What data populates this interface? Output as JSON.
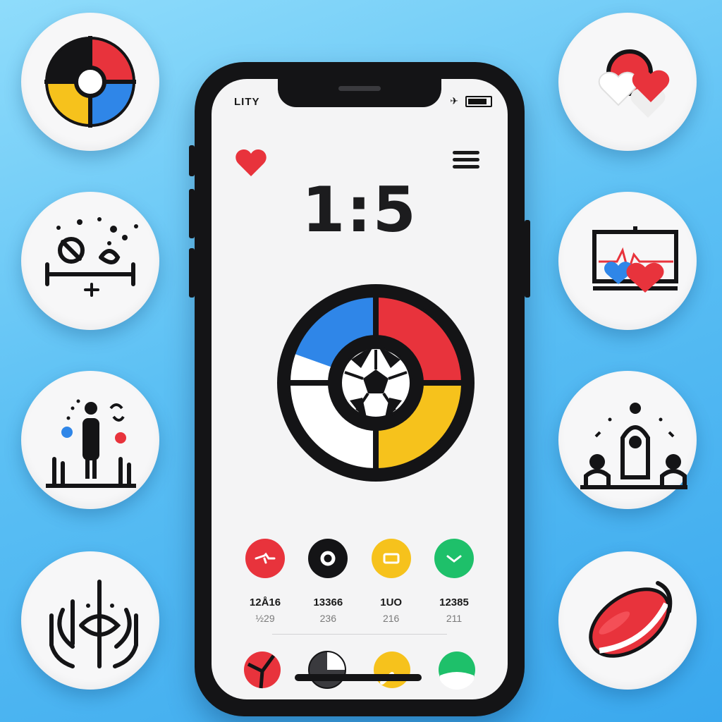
{
  "status_bar": {
    "carrier": "LITY",
    "signal_glyph": "✈"
  },
  "header": {
    "favorite_icon": "heart-icon",
    "menu_icon": "hamburger-menu-icon"
  },
  "match": {
    "score": "1:5"
  },
  "stats": [
    {
      "value": "12Å16",
      "sub": "½29",
      "color": "#e8333c",
      "icon": "red-arrow-icon"
    },
    {
      "value": "13366",
      "sub": "236",
      "color": "#141416",
      "icon": "black-ring-icon"
    },
    {
      "value": "1UO",
      "sub": "216",
      "color": "#f6c21c",
      "icon": "yellow-square-icon"
    },
    {
      "value": "12385",
      "sub": "211",
      "color": "#1ec06a",
      "icon": "green-check-icon"
    }
  ],
  "colors": {
    "red": "#e8333c",
    "blue": "#2f86e8",
    "yellow": "#f6c21c",
    "green": "#1ec06a",
    "black": "#141416"
  },
  "side_badges_left": [
    "pie-chart-icon",
    "fitness-activity-icon",
    "team-players-icon",
    "target-figure-icon"
  ],
  "side_badges_right": [
    "hearts-icon",
    "health-monitor-icon",
    "group-meeting-icon",
    "rugby-ball-icon"
  ]
}
